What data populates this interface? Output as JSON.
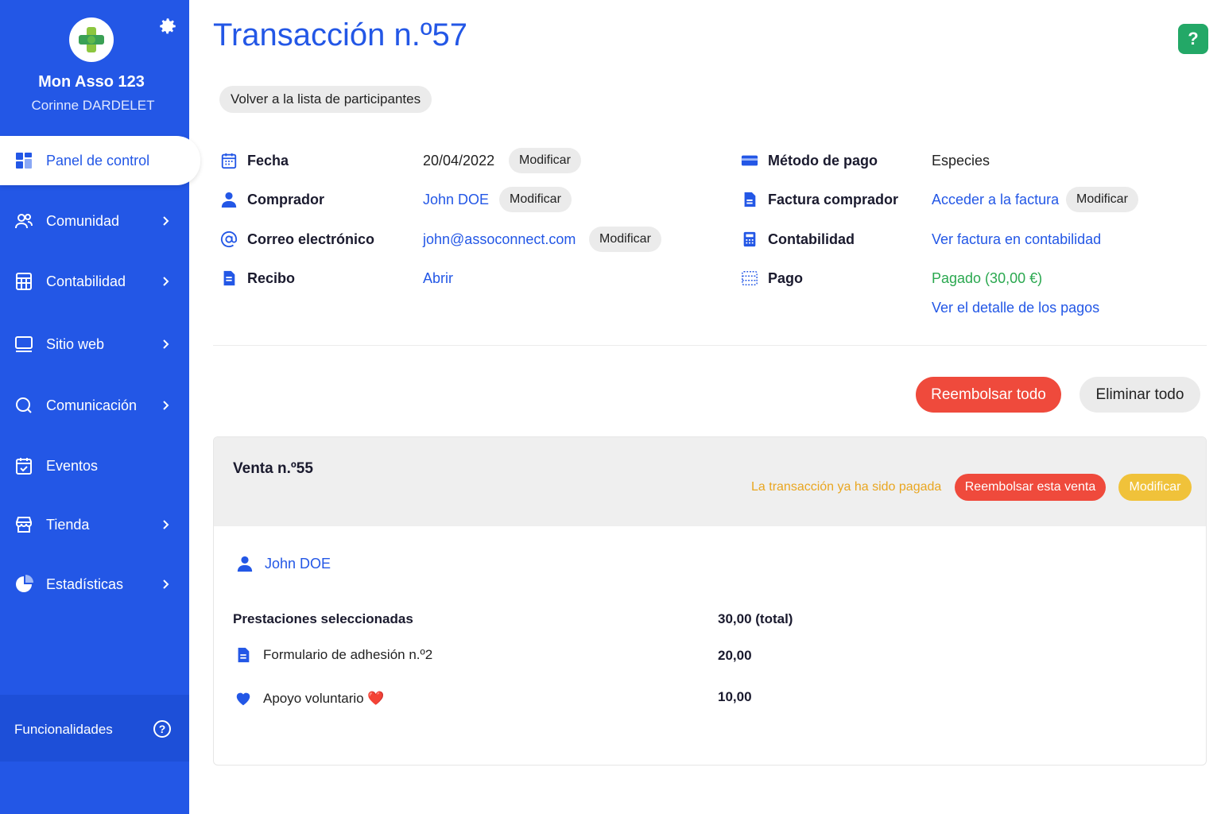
{
  "sidebar": {
    "org_name": "Mon Asso 123",
    "user_name": "Corinne DARDELET",
    "items": [
      {
        "label": "Panel de control",
        "icon": "dashboard-icon",
        "active": true
      },
      {
        "label": "Comunidad",
        "icon": "community-icon"
      },
      {
        "label": "Contabilidad",
        "icon": "calculator-icon"
      },
      {
        "label": "Sitio web",
        "icon": "monitor-icon"
      },
      {
        "label": "Comunicación",
        "icon": "chat-icon"
      },
      {
        "label": "Eventos",
        "icon": "calendar-icon"
      },
      {
        "label": "Tienda",
        "icon": "shop-icon"
      },
      {
        "label": "Estadísticas",
        "icon": "stats-icon"
      }
    ],
    "footer_label": "Funcionalidades"
  },
  "header": {
    "title": "Transacción n.º57",
    "help": "?",
    "back_label": "Volver a la lista de participantes"
  },
  "details": {
    "left": [
      {
        "label": "Fecha",
        "value": "20/04/2022",
        "action": "Modificar"
      },
      {
        "label": "Comprador",
        "value": "John DOE",
        "action": "Modificar"
      },
      {
        "label": "Correo electrónico",
        "value": "john@assoconnect.com",
        "action": "Modificar"
      },
      {
        "label": "Recibo",
        "value": "Abrir"
      }
    ],
    "right": [
      {
        "label": "Método de pago",
        "value": "Especies"
      },
      {
        "label": "Factura comprador",
        "value": "Acceder a la factura",
        "action": "Modificar"
      },
      {
        "label": "Contabilidad",
        "value": "Ver factura en contabilidad"
      },
      {
        "label": "Pago",
        "value": "Pagado (30,00 €)",
        "value2": "Ver el detalle de los pagos"
      }
    ]
  },
  "actions": {
    "refund_all": "Reembolsar todo",
    "delete_all": "Eliminar todo"
  },
  "sale": {
    "title": "Venta n.º55",
    "paid_note": "La transacción ya ha sido pagada",
    "refund_label": "Reembolsar esta venta",
    "modify_label": "Modificar",
    "buyer": "John DOE",
    "selected_title": "Prestaciones seleccionadas",
    "selected_total": "30,00 (total)",
    "items": [
      {
        "label": "Formulario de adhesión n.º2",
        "amount": "20,00",
        "icon": "document-icon"
      },
      {
        "label": "Apoyo voluntario ❤️",
        "amount": "10,00",
        "icon": "heart-icon"
      }
    ]
  },
  "colors": {
    "brand_blue": "#2357e6",
    "refund_red": "#ef4a3c",
    "warning_yellow": "#f0c23a",
    "paid_green": "#2aa84f",
    "help_green": "#23a867"
  }
}
